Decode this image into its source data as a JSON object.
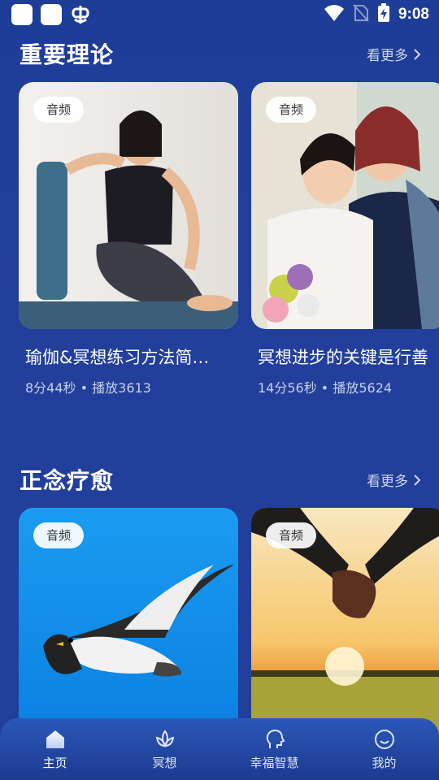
{
  "status_bar": {
    "time": "9:08",
    "left_icons": [
      "app-square-icon",
      "app-square-icon",
      "bug-icon"
    ],
    "right_icons": [
      "wifi-icon",
      "no-sim-icon",
      "battery-charging-icon"
    ]
  },
  "sections": [
    {
      "title": "重要理论",
      "see_more": "看更多",
      "cards": [
        {
          "badge": "音频",
          "title": "瑜伽&冥想练习方法简…",
          "meta": "8分44秒 • 播放3613",
          "image": "woman-yoga-with-foam-roller"
        },
        {
          "badge": "音频",
          "title": "冥想进步的关键是行善",
          "meta": "14分56秒 • 播放5624",
          "image": "two-women-with-flowers"
        }
      ]
    },
    {
      "title": "正念疗愈",
      "see_more": "看更多",
      "cards": [
        {
          "badge": "音频",
          "image": "seagull-blue-sky"
        },
        {
          "badge": "音频",
          "image": "holding-hands-sunset-field"
        }
      ]
    }
  ],
  "tabbar": {
    "items": [
      {
        "label": "主页",
        "icon": "home-icon",
        "active": true
      },
      {
        "label": "冥想",
        "icon": "lotus-icon",
        "active": false
      },
      {
        "label": "幸福智慧",
        "icon": "head-profile-icon",
        "active": false
      },
      {
        "label": "我的",
        "icon": "smiley-face-icon",
        "active": false
      }
    ]
  },
  "colors": {
    "background": "#213f9a",
    "tabbar": "#2b58b9",
    "badge_bg": "#ffffff"
  }
}
